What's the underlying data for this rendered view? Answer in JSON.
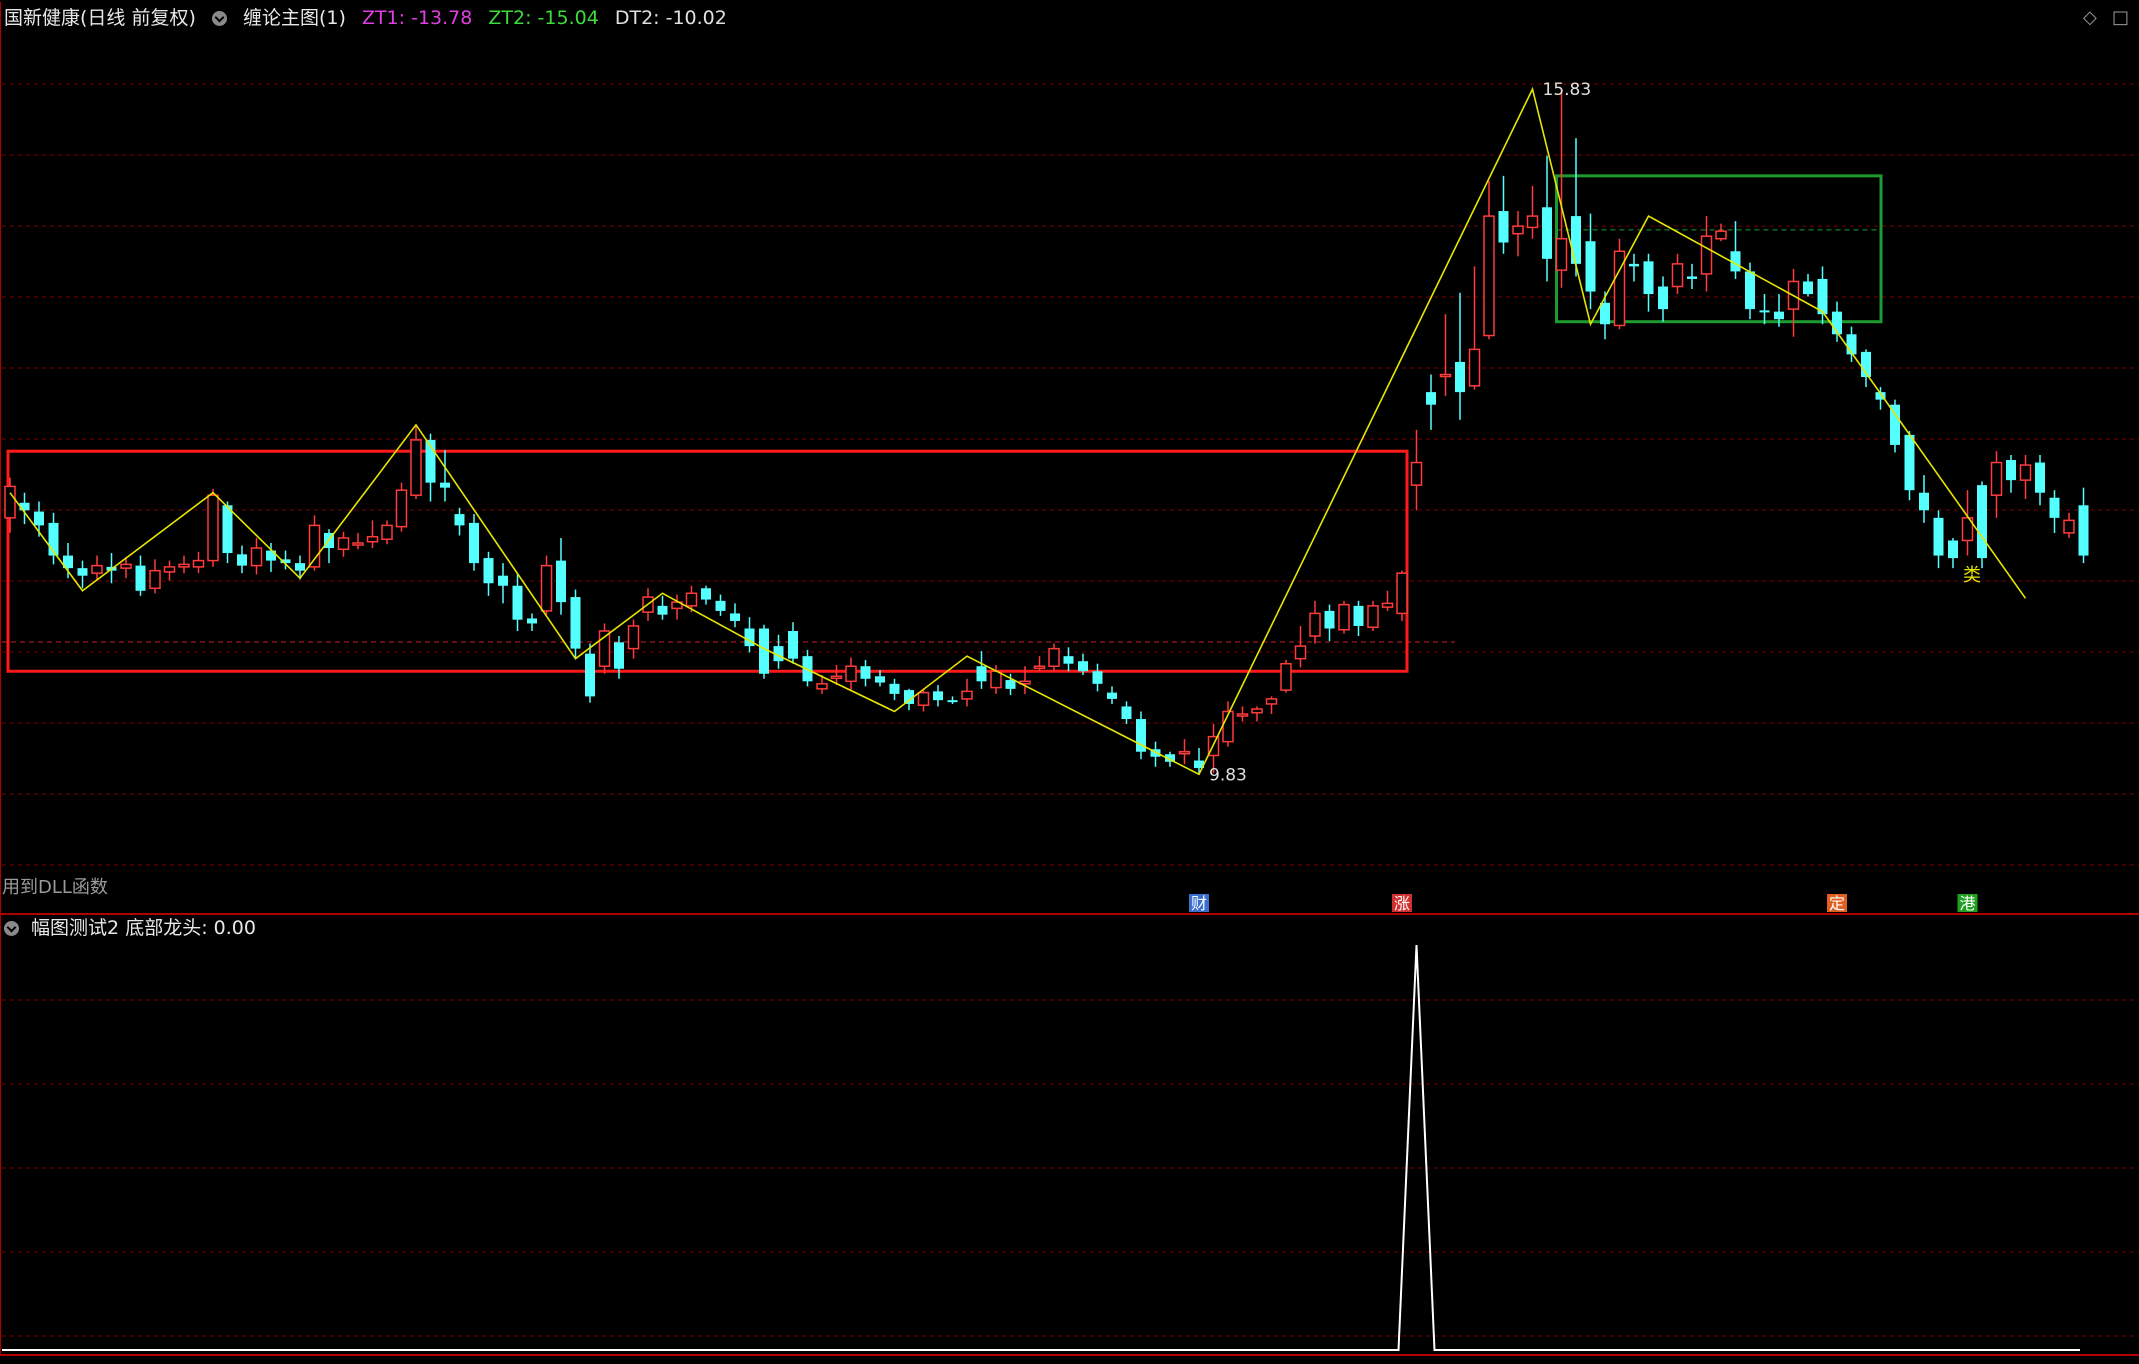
{
  "header": {
    "title": "国新健康(日线 前复权)",
    "indicator_name": "缠论主图(1)",
    "zt1": "ZT1: -13.78",
    "zt2": "ZT2: -15.04",
    "dt2": "DT2: -10.02"
  },
  "sub_header": {
    "indicator_name": "幅图测试2",
    "value_text": "底部龙头: 0.00"
  },
  "dll_text": "用到DLL函数",
  "corner_icons": [
    "diamond-icon",
    "maximize-icon"
  ],
  "colors": {
    "up": "#ff3b3b",
    "down": "#54ffff",
    "zigzag": "#e6e600",
    "box_red": "#ff1a1a",
    "box_green": "#1f9a2e",
    "grid": "#7a0000",
    "spike": "#ffffff"
  },
  "chart_data": [
    {
      "type": "candlestick",
      "title": "国新健康(日线 前复权)",
      "price_range": [
        9.5,
        16.3
      ],
      "grid": "dashed horizontal",
      "candles": [
        [
          12.42,
          12.67,
          12.3,
          12.74
        ],
        [
          12.54,
          12.48,
          12.37,
          12.62
        ],
        [
          12.47,
          12.36,
          12.27,
          12.55
        ],
        [
          12.38,
          12.12,
          12.05,
          12.46
        ],
        [
          12.12,
          12.02,
          11.94,
          12.22
        ],
        [
          12.02,
          11.96,
          11.86,
          12.08
        ],
        [
          11.98,
          12.04,
          11.92,
          12.12
        ],
        [
          12.03,
          12.0,
          11.9,
          12.14
        ],
        [
          12.02,
          12.05,
          11.94,
          12.11
        ],
        [
          12.04,
          11.84,
          11.8,
          12.12
        ],
        [
          11.86,
          12.0,
          11.82,
          12.09
        ],
        [
          11.99,
          12.03,
          11.92,
          12.08
        ],
        [
          12.03,
          12.05,
          11.98,
          12.12
        ],
        [
          12.03,
          12.08,
          11.98,
          12.15
        ],
        [
          12.08,
          12.6,
          12.03,
          12.65
        ],
        [
          12.52,
          12.14,
          12.06,
          12.55
        ],
        [
          12.13,
          12.04,
          11.98,
          12.2
        ],
        [
          12.04,
          12.18,
          11.97,
          12.26
        ],
        [
          12.16,
          12.08,
          11.99,
          12.22
        ],
        [
          12.09,
          12.06,
          12.01,
          12.16
        ],
        [
          12.06,
          12.0,
          11.93,
          12.12
        ],
        [
          12.03,
          12.36,
          12.0,
          12.44
        ],
        [
          12.3,
          12.18,
          12.06,
          12.33
        ],
        [
          12.17,
          12.26,
          12.11,
          12.31
        ],
        [
          12.21,
          12.22,
          12.17,
          12.3
        ],
        [
          12.23,
          12.27,
          12.18,
          12.4
        ],
        [
          12.25,
          12.36,
          12.21,
          12.4
        ],
        [
          12.35,
          12.64,
          12.31,
          12.7
        ],
        [
          12.6,
          13.04,
          12.57,
          13.16
        ],
        [
          13.04,
          12.7,
          12.55,
          13.09
        ],
        [
          12.7,
          12.66,
          12.55,
          12.96
        ],
        [
          12.45,
          12.36,
          12.28,
          12.5
        ],
        [
          12.38,
          12.06,
          12.0,
          12.45
        ],
        [
          12.1,
          11.9,
          11.8,
          12.15
        ],
        [
          11.96,
          11.88,
          11.74,
          12.06
        ],
        [
          11.88,
          11.61,
          11.52,
          11.98
        ],
        [
          11.62,
          11.58,
          11.52,
          11.66
        ],
        [
          11.68,
          12.04,
          11.65,
          12.12
        ],
        [
          12.08,
          11.75,
          11.65,
          12.26
        ],
        [
          11.79,
          11.38,
          11.3,
          11.85
        ],
        [
          11.34,
          11.0,
          10.95,
          11.42
        ],
        [
          11.24,
          11.52,
          11.18,
          11.58
        ],
        [
          11.43,
          11.22,
          11.14,
          11.48
        ],
        [
          11.38,
          11.56,
          11.3,
          11.61
        ],
        [
          11.67,
          11.79,
          11.6,
          11.86
        ],
        [
          11.72,
          11.65,
          11.61,
          11.8
        ],
        [
          11.7,
          11.75,
          11.61,
          11.81
        ],
        [
          11.72,
          11.82,
          11.67,
          11.88
        ],
        [
          11.86,
          11.77,
          11.73,
          11.88
        ],
        [
          11.76,
          11.68,
          11.64,
          11.81
        ],
        [
          11.66,
          11.6,
          11.55,
          11.74
        ],
        [
          11.54,
          11.4,
          11.35,
          11.63
        ],
        [
          11.54,
          11.18,
          11.14,
          11.57
        ],
        [
          11.4,
          11.28,
          11.22,
          11.49
        ],
        [
          11.52,
          11.3,
          11.26,
          11.59
        ],
        [
          11.32,
          11.12,
          11.08,
          11.37
        ],
        [
          11.06,
          11.1,
          11.02,
          11.17
        ],
        [
          11.16,
          11.16,
          11.09,
          11.25
        ],
        [
          11.12,
          11.24,
          11.05,
          11.31
        ],
        [
          11.24,
          11.14,
          11.08,
          11.29
        ],
        [
          11.16,
          11.11,
          11.08,
          11.21
        ],
        [
          11.1,
          11.02,
          10.97,
          11.14
        ],
        [
          11.05,
          10.94,
          10.89,
          11.06
        ],
        [
          10.93,
          11.03,
          10.88,
          11.06
        ],
        [
          11.04,
          10.97,
          10.92,
          11.09
        ],
        [
          10.97,
          10.96,
          10.94,
          11.0
        ],
        [
          10.98,
          11.04,
          10.92,
          11.14
        ],
        [
          11.24,
          11.12,
          11.06,
          11.36
        ],
        [
          11.07,
          11.2,
          11.02,
          11.25
        ],
        [
          11.13,
          11.06,
          11.01,
          11.18
        ],
        [
          11.1,
          11.12,
          11.02,
          11.24
        ],
        [
          11.24,
          11.24,
          11.2,
          11.32
        ],
        [
          11.24,
          11.38,
          11.2,
          11.42
        ],
        [
          11.32,
          11.26,
          11.2,
          11.39
        ],
        [
          11.28,
          11.2,
          11.17,
          11.34
        ],
        [
          11.2,
          11.1,
          11.04,
          11.26
        ],
        [
          11.03,
          10.98,
          10.94,
          11.08
        ],
        [
          10.92,
          10.82,
          10.78,
          10.96
        ],
        [
          10.82,
          10.56,
          10.5,
          10.88
        ],
        [
          10.58,
          10.52,
          10.44,
          10.64
        ],
        [
          10.54,
          10.48,
          10.44,
          10.56
        ],
        [
          10.55,
          10.56,
          10.46,
          10.66
        ],
        [
          10.49,
          10.43,
          10.38,
          10.59
        ],
        [
          10.53,
          10.68,
          10.39,
          10.78
        ],
        [
          10.64,
          10.88,
          10.6,
          10.96
        ],
        [
          10.85,
          10.86,
          10.8,
          10.92
        ],
        [
          10.87,
          10.9,
          10.8,
          10.92
        ],
        [
          10.94,
          10.98,
          10.86,
          11.0
        ],
        [
          11.05,
          11.26,
          11.03,
          11.29
        ],
        [
          11.3,
          11.4,
          11.23,
          11.56
        ],
        [
          11.48,
          11.66,
          11.42,
          11.76
        ],
        [
          11.68,
          11.54,
          11.44,
          11.73
        ],
        [
          11.53,
          11.73,
          11.5,
          11.76
        ],
        [
          11.72,
          11.56,
          11.48,
          11.76
        ],
        [
          11.55,
          11.72,
          11.52,
          11.76
        ],
        [
          11.71,
          11.74,
          11.68,
          11.84
        ],
        [
          11.66,
          11.98,
          11.6,
          12.0
        ],
        [
          12.68,
          12.86,
          12.48,
          13.12
        ],
        [
          13.42,
          13.32,
          13.12,
          13.56
        ],
        [
          13.55,
          13.56,
          13.39,
          14.04
        ],
        [
          13.66,
          13.42,
          13.2,
          14.21
        ],
        [
          13.47,
          13.76,
          13.44,
          14.42
        ],
        [
          13.87,
          14.82,
          13.84,
          15.1
        ],
        [
          14.86,
          14.61,
          14.52,
          15.14
        ],
        [
          14.68,
          14.74,
          14.5,
          14.86
        ],
        [
          14.73,
          14.82,
          14.64,
          15.06
        ],
        [
          14.89,
          14.48,
          14.3,
          15.3
        ],
        [
          14.39,
          14.64,
          14.25,
          15.83
        ],
        [
          14.82,
          14.44,
          14.34,
          15.44
        ],
        [
          14.62,
          14.22,
          14.08,
          14.84
        ],
        [
          14.13,
          13.96,
          13.84,
          14.22
        ],
        [
          13.95,
          14.54,
          13.92,
          14.64
        ],
        [
          14.44,
          14.42,
          14.3,
          14.52
        ],
        [
          14.46,
          14.2,
          14.06,
          14.52
        ],
        [
          14.26,
          14.08,
          13.98,
          14.34
        ],
        [
          14.26,
          14.44,
          14.2,
          14.52
        ],
        [
          14.34,
          14.32,
          14.24,
          14.44
        ],
        [
          14.36,
          14.66,
          14.22,
          14.82
        ],
        [
          14.64,
          14.7,
          14.62,
          14.76
        ],
        [
          14.54,
          14.38,
          14.32,
          14.78
        ],
        [
          14.38,
          14.08,
          14.0,
          14.45
        ],
        [
          14.07,
          14.06,
          13.96,
          14.2
        ],
        [
          14.06,
          14.0,
          13.94,
          14.2
        ],
        [
          14.08,
          14.3,
          13.86,
          14.4
        ],
        [
          14.3,
          14.2,
          14.18,
          14.36
        ],
        [
          14.32,
          14.04,
          13.96,
          14.42
        ],
        [
          14.06,
          13.88,
          13.82,
          14.14
        ],
        [
          13.88,
          13.72,
          13.66,
          13.94
        ],
        [
          13.74,
          13.54,
          13.46,
          13.76
        ],
        [
          13.42,
          13.36,
          13.28,
          13.46
        ],
        [
          13.32,
          13.0,
          12.94,
          13.36
        ],
        [
          13.08,
          12.64,
          12.56,
          13.11
        ],
        [
          12.62,
          12.48,
          12.38,
          12.76
        ],
        [
          12.42,
          12.12,
          12.02,
          12.48
        ],
        [
          12.24,
          12.1,
          12.02,
          12.26
        ],
        [
          12.24,
          12.42,
          12.12,
          12.64
        ],
        [
          12.68,
          12.1,
          12.02,
          12.71
        ],
        [
          12.6,
          12.86,
          12.42,
          12.95
        ],
        [
          12.88,
          12.72,
          12.62,
          12.92
        ],
        [
          12.72,
          12.84,
          12.57,
          12.92
        ],
        [
          12.86,
          12.62,
          12.52,
          12.92
        ],
        [
          12.58,
          12.42,
          12.3,
          12.64
        ],
        [
          12.3,
          12.4,
          12.26,
          12.46
        ],
        [
          12.52,
          12.12,
          12.06,
          12.66
        ]
      ],
      "zigzag": [
        [
          0,
          12.62
        ],
        [
          5,
          11.84
        ],
        [
          14,
          12.62
        ],
        [
          20,
          11.94
        ],
        [
          28,
          13.16
        ],
        [
          39,
          11.3
        ],
        [
          45,
          11.82
        ],
        [
          52,
          11.38
        ],
        [
          61,
          10.88
        ],
        [
          66,
          11.32
        ],
        [
          82,
          10.38
        ],
        [
          105,
          15.83
        ],
        [
          109,
          13.96
        ],
        [
          113,
          14.82
        ],
        [
          125,
          14.06
        ],
        [
          139,
          11.78
        ]
      ],
      "annotations": [
        {
          "text": "15.83",
          "x": 105,
          "y": 15.83
        },
        {
          "text": "9.83",
          "x": 82,
          "y": 10.38
        }
      ],
      "bottom_markers": [
        "财",
        "涨",
        "定",
        "港"
      ],
      "pivot_label": "类",
      "red_box": {
        "x_range": [
          0,
          96
        ],
        "y_range": [
          11.2,
          12.95
        ]
      },
      "green_box": {
        "x_range": [
          107,
          128
        ],
        "y_range": [
          13.98,
          15.14
        ]
      }
    },
    {
      "type": "line",
      "title": "幅图测试2",
      "series": [
        {
          "name": "底部龙头",
          "spike_at": 97,
          "spike_value": 1,
          "base": 0
        }
      ]
    }
  ]
}
